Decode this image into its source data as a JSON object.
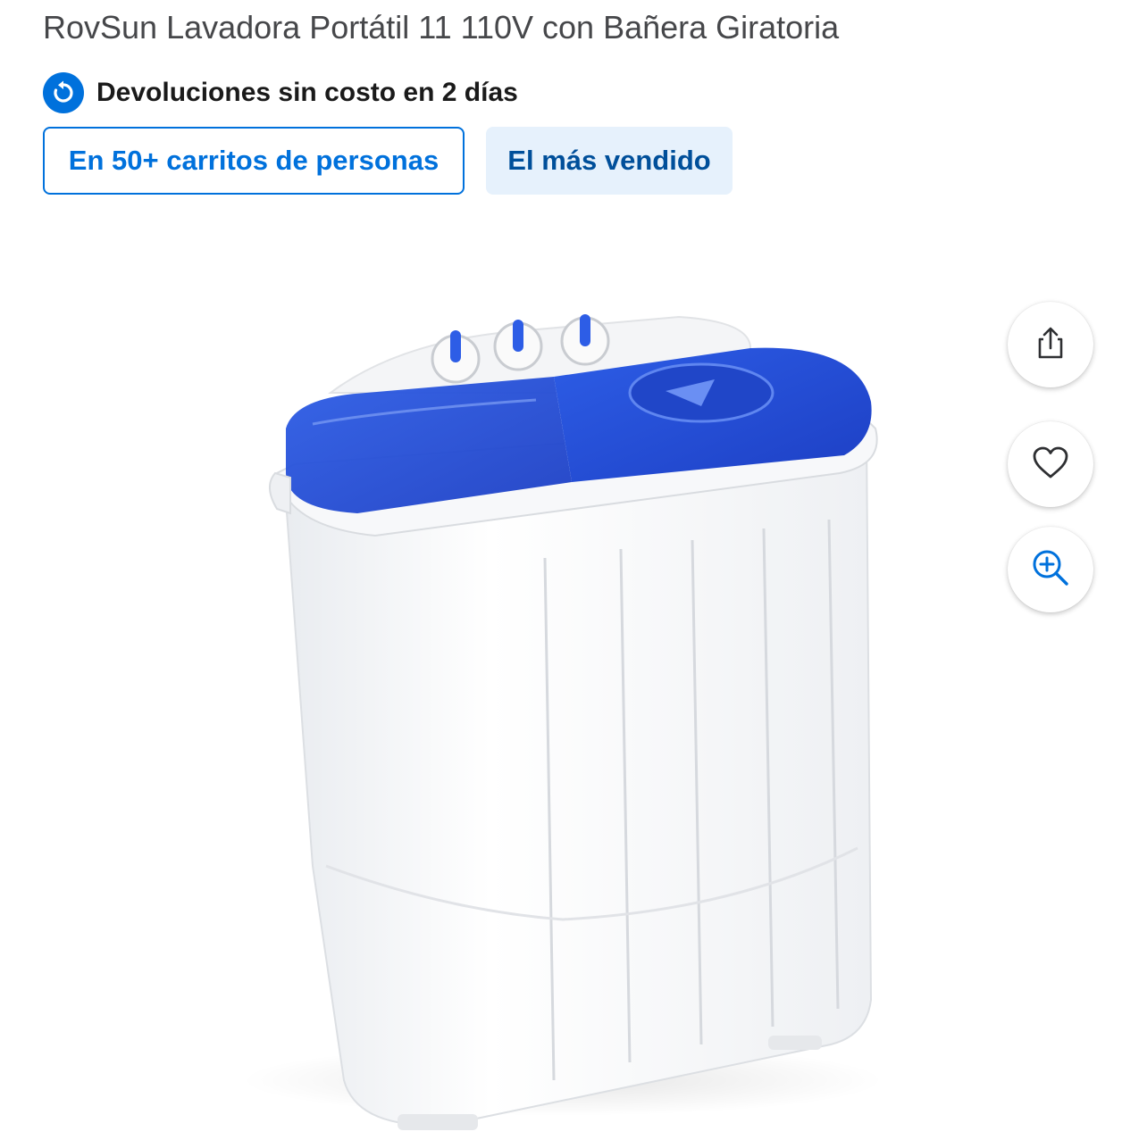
{
  "product": {
    "title": "RovSun Lavadora Portátil 11 110V con Bañera Giratoria",
    "image_alt": "Lavadora portátil de doble tina blanca con tapas azules"
  },
  "returns": {
    "text": "Devoluciones sin costo en 2 días",
    "icon": "return-arrow-icon"
  },
  "badges": [
    {
      "label": "En 50+ carritos de personas"
    },
    {
      "label": "El más vendido"
    }
  ],
  "actions": {
    "share_icon": "share-icon",
    "favorite_icon": "heart-icon",
    "zoom_icon": "zoom-in-icon"
  },
  "colors": {
    "accent": "#0071dc",
    "best_seller_bg": "#e6f1fc",
    "best_seller_text": "#004f9a",
    "lid_blue": "#2a55d8"
  }
}
